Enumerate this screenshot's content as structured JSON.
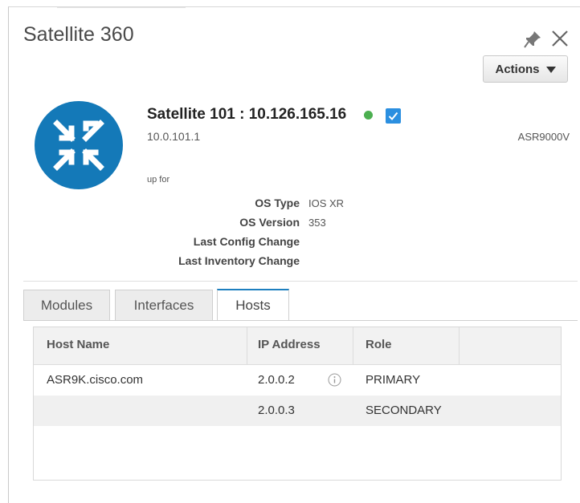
{
  "window": {
    "title": "Satellite 360"
  },
  "toolbar": {
    "actions_label": "Actions"
  },
  "device": {
    "name": "Satellite 101 : 10.126.165.16",
    "ip": "10.0.101.1",
    "model": "ASR9000V",
    "uptime_label": "up for",
    "status_color": "#4caf50",
    "icon": "satellite-device-icon"
  },
  "details": [
    {
      "label": "OS Type",
      "value": "IOS XR"
    },
    {
      "label": "OS Version",
      "value": "353"
    },
    {
      "label": "Last Config Change",
      "value": ""
    },
    {
      "label": "Last Inventory Change",
      "value": ""
    }
  ],
  "tabs": [
    {
      "label": "Modules",
      "active": false
    },
    {
      "label": "Interfaces",
      "active": false
    },
    {
      "label": "Hosts",
      "active": true
    }
  ],
  "hosts_table": {
    "columns": [
      "Host Name",
      "IP Address",
      "Role",
      ""
    ],
    "rows": [
      {
        "host": "ASR9K.cisco.com",
        "ip": "2.0.0.2",
        "role": "PRIMARY",
        "info": true
      },
      {
        "host": "",
        "ip": "2.0.0.3",
        "role": "SECONDARY",
        "info": false
      }
    ]
  },
  "colors": {
    "accent": "#1d7fbf",
    "checkbox": "#2b8fe0",
    "device_icon_bg": "#1479b8"
  }
}
